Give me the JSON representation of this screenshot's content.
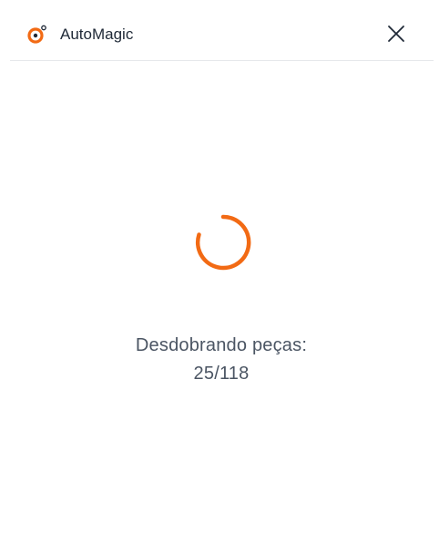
{
  "header": {
    "app_name": "AutoMagic",
    "logo_icon": "automagic-logo-icon",
    "close_icon": "close-icon"
  },
  "progress": {
    "label": "Desdobrando peças:",
    "count_text": "25/118",
    "current": 25,
    "total": 118,
    "spinner_icon": "loading-spinner-icon"
  },
  "colors": {
    "accent": "#f26a14",
    "text_primary": "#1f2937",
    "text_secondary": "#4b5563",
    "divider": "#e5e7eb"
  }
}
